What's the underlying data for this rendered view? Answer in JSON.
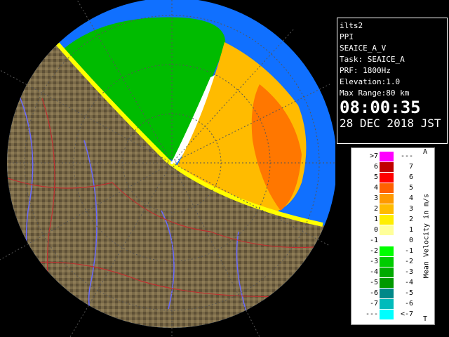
{
  "info": {
    "station": "ilts2",
    "product": "PPI",
    "scan": "SEAICE_A_V",
    "task": "Task: SEAICE_A",
    "prf": "PRF: 1800Hz",
    "elevation": "Elevation:1.0",
    "max_range": "Max Range:80 km",
    "time": "08:00:35",
    "date": "28 DEC 2018 JST"
  },
  "legend": {
    "title": "Mean Velocity in m/s",
    "top_marker": "A",
    "bottom_marker": "T",
    "rows": [
      {
        "left": ">7",
        "right": "---",
        "color": "#ff00ff"
      },
      {
        "left": "6",
        "right": "7",
        "color": "#c00000"
      },
      {
        "left": "5",
        "right": "6",
        "color": "#ff0000"
      },
      {
        "left": "4",
        "right": "5",
        "color": "#ff6000"
      },
      {
        "left": "3",
        "right": "4",
        "color": "#ff9900"
      },
      {
        "left": "2",
        "right": "3",
        "color": "#ffbb00"
      },
      {
        "left": "1",
        "right": "2",
        "color": "#ffee00"
      },
      {
        "left": "0",
        "right": "1",
        "color": "#ffff99"
      },
      {
        "left": "-1",
        "right": "0",
        "color": "#ffffff"
      },
      {
        "left": "-2",
        "right": "-1",
        "color": "#00ff00"
      },
      {
        "left": "-3",
        "right": "-2",
        "color": "#00cc00"
      },
      {
        "left": "-4",
        "right": "-3",
        "color": "#00aa00"
      },
      {
        "left": "-5",
        "right": "-4",
        "color": "#009900"
      },
      {
        "left": "-6",
        "right": "-5",
        "color": "#008888"
      },
      {
        "left": "-7",
        "right": "-6",
        "color": "#00bbbb"
      },
      {
        "left": "---",
        "right": "<-7",
        "color": "#00ffff"
      }
    ]
  },
  "colors": {
    "sea": "#1070ff",
    "land": "#7a6a48",
    "background": "#000000"
  }
}
